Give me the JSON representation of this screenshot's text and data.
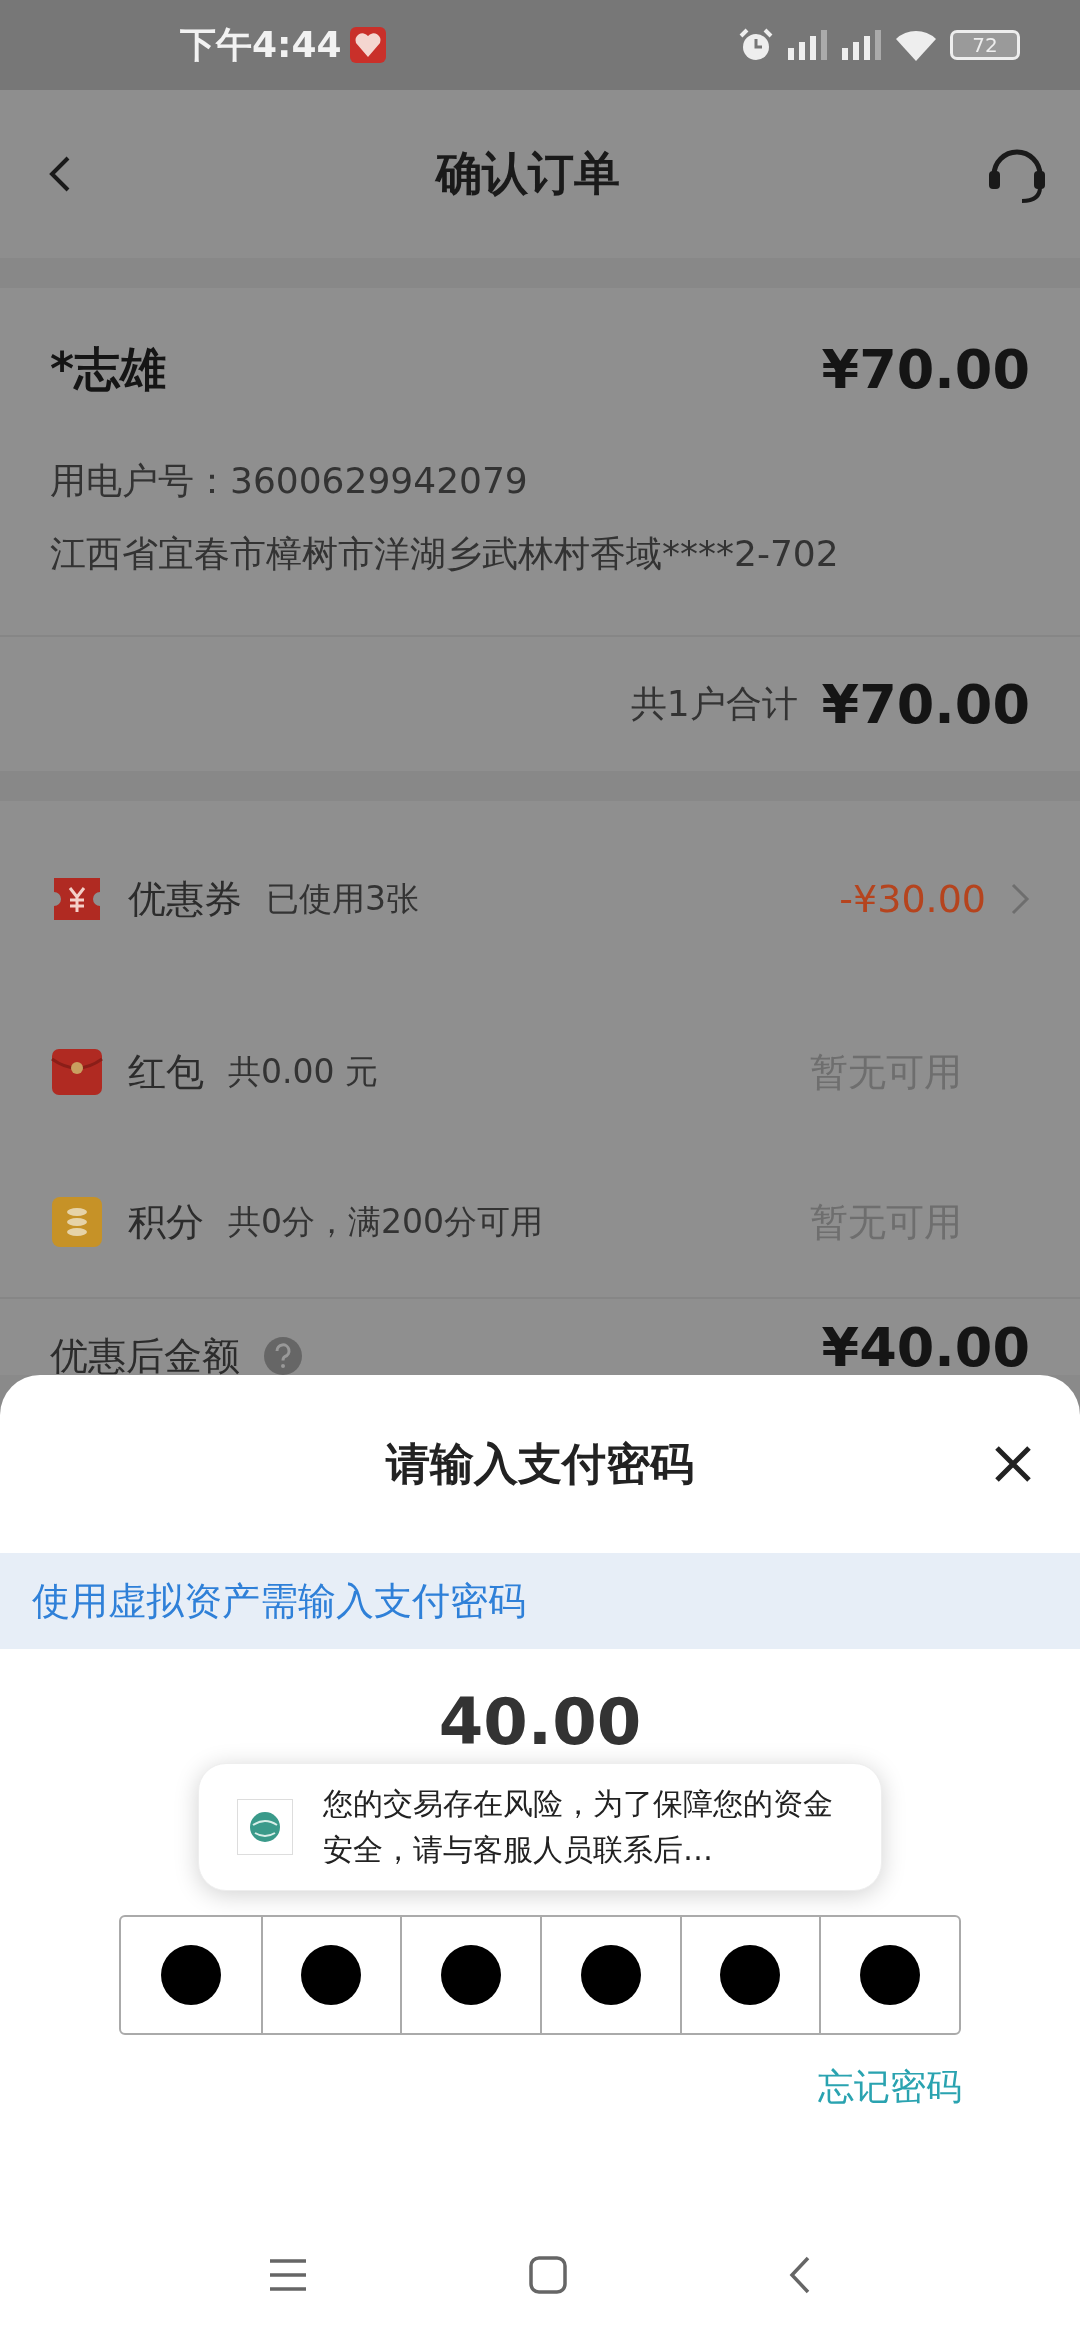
{
  "status_bar": {
    "time": "下午4:44",
    "battery": "72"
  },
  "header": {
    "title": "确认订单"
  },
  "order": {
    "name": "*志雄",
    "amount": "¥70.00",
    "account_label": "用电户号：",
    "account": "3600629942079",
    "address": "江西省宜春市樟树市洋湖乡武林村香域****2-702",
    "total_label": "共1户合计",
    "total": "¥70.00"
  },
  "discounts": [
    {
      "kind": "coupon",
      "label": "优惠券",
      "detail": "已使用3张",
      "value": "-¥30.00",
      "available": true
    },
    {
      "kind": "redpacket",
      "label": "红包",
      "detail": "共0.00 元",
      "value": "暂无可用",
      "available": false
    },
    {
      "kind": "points",
      "label": "积分",
      "detail": "共0分，满200分可用",
      "value": "暂无可用",
      "available": false
    }
  ],
  "final": {
    "label": "优惠后金额",
    "amount": "¥40.00"
  },
  "sheet": {
    "title": "请输入支付密码",
    "notice": "使用虚拟资产需输入支付密码",
    "amount": "40.00",
    "pin": [
      {
        "filled": true
      },
      {
        "filled": true
      },
      {
        "filled": true
      },
      {
        "filled": true
      },
      {
        "filled": true
      },
      {
        "filled": true
      }
    ],
    "forgot": "忘记密码"
  },
  "toast": {
    "message": "您的交易存在风险，为了保障您的资金安全，请与客服人员联系后…"
  }
}
